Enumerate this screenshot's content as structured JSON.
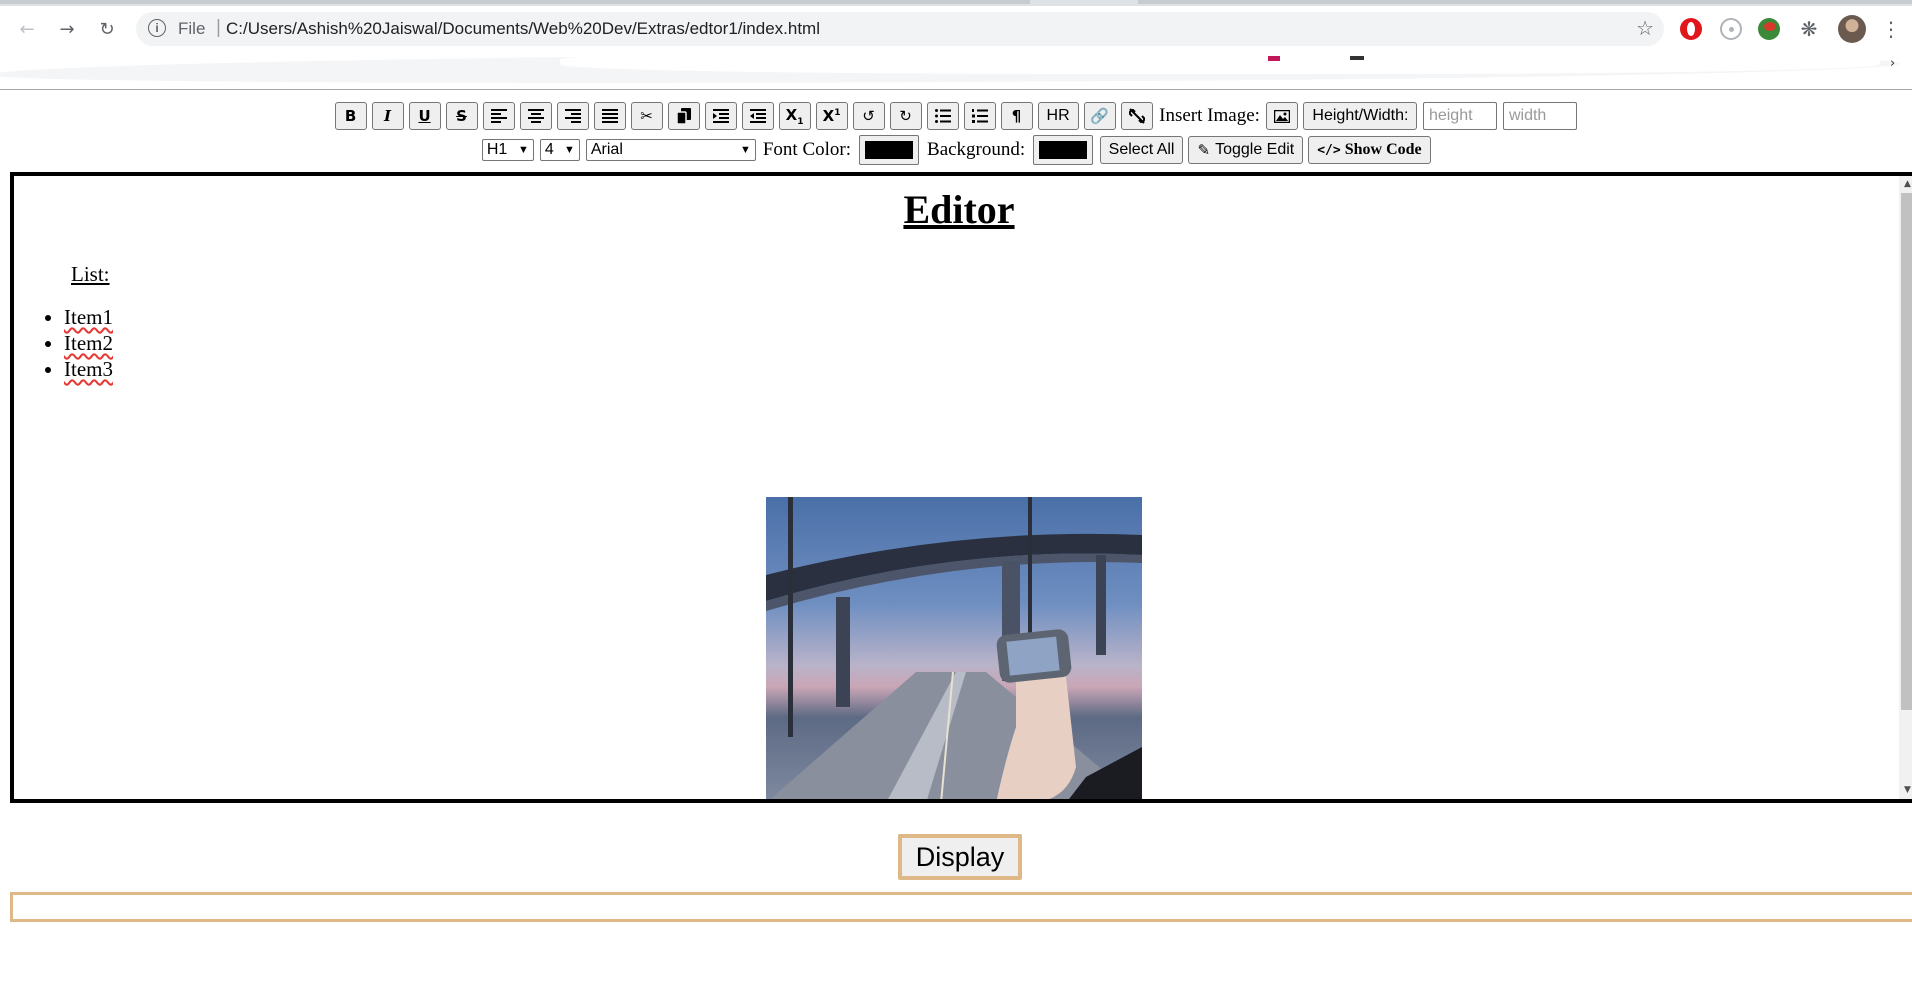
{
  "browser": {
    "scheme_label": "File",
    "url": "C:/Users/Ashish%20Jaiswal/Documents/Web%20Dev/Extras/edtor1/index.html",
    "icons": [
      "back-arrow-icon",
      "forward-arrow-icon",
      "reload-icon",
      "info-icon",
      "bookmark-star-icon",
      "opera-extension-icon",
      "react-devtools-icon",
      "globe-extension-icon",
      "extensions-puzzle-icon",
      "profile-avatar",
      "chrome-menu-icon"
    ]
  },
  "toolbar": {
    "row1": {
      "bold": "B",
      "italic": "I",
      "underline": "U",
      "strike": "S",
      "hr": "HR",
      "insert_image_label": "Insert Image:",
      "height_width_button": "Height/Width:",
      "height_placeholder": "height",
      "width_placeholder": "width"
    },
    "row2": {
      "heading_select": "H1",
      "size_select": "4",
      "font_select": "Arial",
      "font_color_label": "Font Color:",
      "background_label": "Background:",
      "select_all": "Select All",
      "toggle_edit": "Toggle Edit",
      "show_code": "Show Code"
    }
  },
  "editor": {
    "heading": "Editor",
    "list_label": "List:",
    "list_items": [
      "Item1",
      "Item2",
      "Item3"
    ]
  },
  "display_button": "Display",
  "colors": {
    "font_color": "#000000",
    "background_color": "#000000",
    "display_border": "#deb887"
  }
}
